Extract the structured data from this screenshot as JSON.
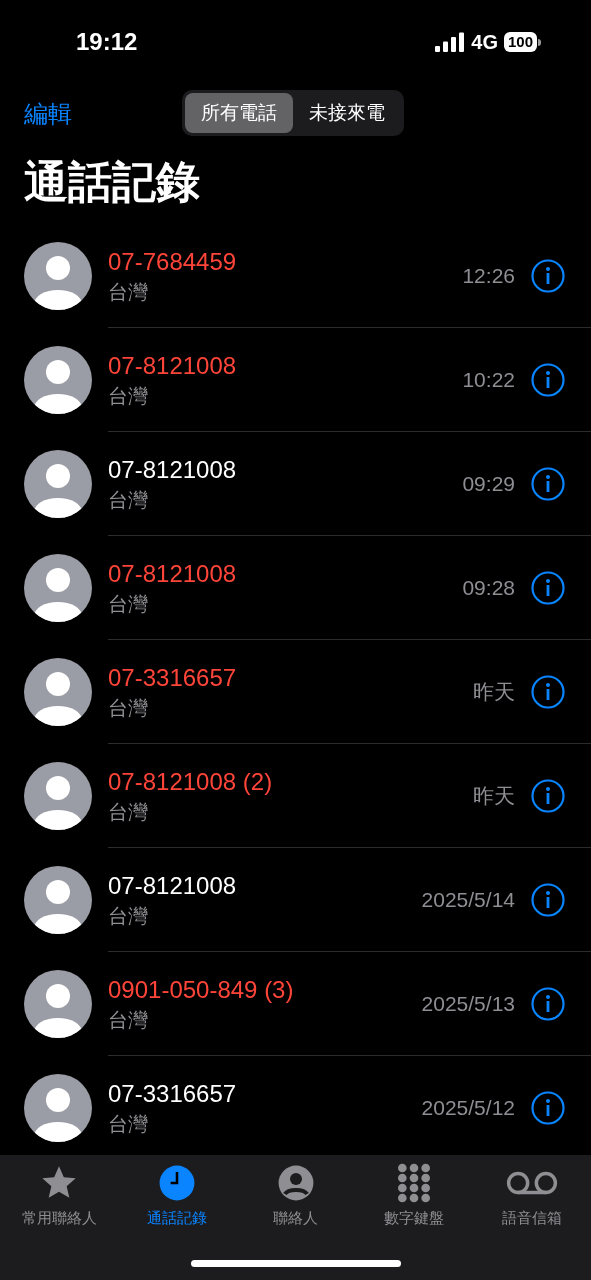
{
  "status_bar": {
    "time": "19:12",
    "network": "4G",
    "battery": "100"
  },
  "nav": {
    "edit": "編輯",
    "segments": [
      {
        "label": "所有電話",
        "selected": true
      },
      {
        "label": "未接來電",
        "selected": false
      }
    ]
  },
  "title": "通話記錄",
  "calls": [
    {
      "number": "07-7684459",
      "location": "台灣",
      "time": "12:26",
      "missed": true
    },
    {
      "number": "07-8121008",
      "location": "台灣",
      "time": "10:22",
      "missed": true
    },
    {
      "number": "07-8121008",
      "location": "台灣",
      "time": "09:29",
      "missed": false
    },
    {
      "number": "07-8121008",
      "location": "台灣",
      "time": "09:28",
      "missed": true
    },
    {
      "number": "07-3316657",
      "location": "台灣",
      "time": "昨天",
      "missed": true
    },
    {
      "number": "07-8121008 (2)",
      "location": "台灣",
      "time": "昨天",
      "missed": true
    },
    {
      "number": "07-8121008",
      "location": "台灣",
      "time": "2025/5/14",
      "missed": false
    },
    {
      "number": "0901-050-849 (3)",
      "location": "台灣",
      "time": "2025/5/13",
      "missed": true
    },
    {
      "number": "07-3316657",
      "location": "台灣",
      "time": "2025/5/12",
      "missed": false
    }
  ],
  "tab_bar": [
    {
      "kind": "favorites",
      "label": "常用聯絡人",
      "selected": false
    },
    {
      "kind": "recents",
      "label": "通話記錄",
      "selected": true
    },
    {
      "kind": "contacts",
      "label": "聯絡人",
      "selected": false
    },
    {
      "kind": "keypad",
      "label": "數字鍵盤",
      "selected": false
    },
    {
      "kind": "voicemail",
      "label": "語音信箱",
      "selected": false
    }
  ]
}
